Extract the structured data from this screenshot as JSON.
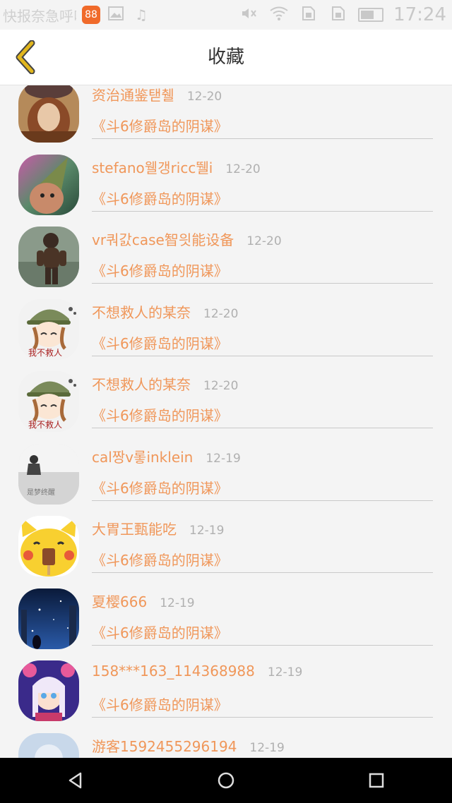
{
  "status_bar": {
    "notification_text": "快报奈急呼叫",
    "app_badge": "88",
    "icons": [
      "image-icon",
      "music-icon",
      "mute-icon",
      "wifi-icon",
      "sim1-icon",
      "sim2-icon",
      "battery-icon"
    ],
    "battery_level": 0.75,
    "time": "17:24"
  },
  "header": {
    "title": "收藏",
    "back_icon": "chevron-left-icon",
    "accent_color": "#e1b61d"
  },
  "theme": {
    "name_color": "#f0975a",
    "date_color": "#b0b0b0",
    "divider_color": "#c9c9c9"
  },
  "favorites": [
    {
      "name": "资治通鉴탣췔",
      "date": "12-20",
      "book": "《斗6修爵岛的阴谋》",
      "avatar": "avatar-hat-girl"
    },
    {
      "name": "stefano웰갱ricc뛜i",
      "date": "12-20",
      "book": "《斗6修爵岛的阴谋》",
      "avatar": "avatar-party-hat"
    },
    {
      "name": "vr쿼갌case智읫能设备",
      "date": "12-20",
      "book": "《斗6修爵岛的阴谋》",
      "avatar": "avatar-child-photo"
    },
    {
      "name": "不想救人的某奈",
      "date": "12-20",
      "book": "《斗6修爵岛的阴谋》",
      "avatar": "avatar-anime-cap"
    },
    {
      "name": "不想救人的某奈",
      "date": "12-20",
      "book": "《斗6修爵岛的阴谋》",
      "avatar": "avatar-anime-cap"
    },
    {
      "name": "cal짱v롷inklein",
      "date": "12-19",
      "book": "《斗6修爵岛的阴谋》",
      "avatar": "avatar-grey-figure"
    },
    {
      "name": "大胃王甄能吃",
      "date": "12-19",
      "book": "《斗6修爵岛的阴谋》",
      "avatar": "avatar-yellow-pikachu"
    },
    {
      "name": "夏樱666",
      "date": "12-19",
      "book": "《斗6修爵岛的阴谋》",
      "avatar": "avatar-night-sky"
    },
    {
      "name": "158***163_114368988",
      "date": "12-19",
      "book": "《斗6修爵岛的阴谋》",
      "avatar": "avatar-anime-girl"
    },
    {
      "name": "游客1592455296194",
      "date": "12-19",
      "book": "",
      "avatar": "avatar-default-guest"
    }
  ],
  "avatar_texts": {
    "anime_cap": "我不救人",
    "grey_figure": "是梦终醒"
  },
  "nav_bar": {
    "buttons": [
      "back-triangle-icon",
      "home-circle-icon",
      "recents-square-icon"
    ]
  }
}
